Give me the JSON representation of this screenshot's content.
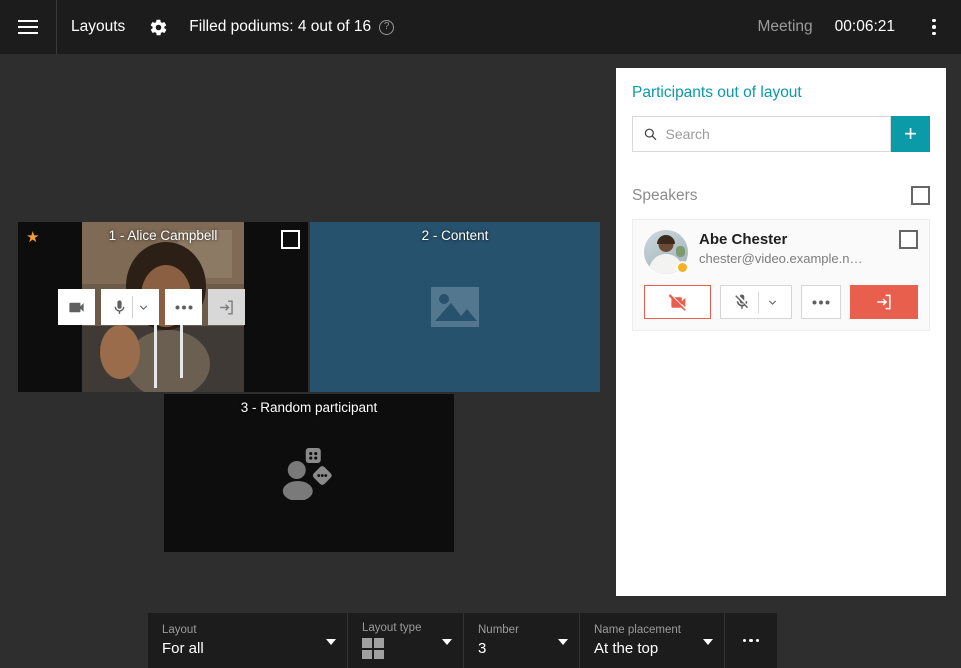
{
  "header": {
    "menu_icon": "hamburger-icon",
    "title": "Layouts",
    "settings_icon": "gear-icon",
    "podiums_text": "Filled podiums: 4 out of 16",
    "help_icon_label": "?",
    "meeting_label": "Meeting",
    "timer": "00:06:21",
    "more_icon": "kebab-menu-icon"
  },
  "stage": {
    "tiles": [
      {
        "name": "1 - Alice Campbell",
        "starred": true,
        "checked": false,
        "controls": {
          "camera": "camera-icon",
          "microphone": "microphone-icon",
          "mic_dropdown": "chevron-down-icon",
          "more": "ellipsis-icon",
          "exit": "exit-icon"
        }
      },
      {
        "name": "2 - Content",
        "icon": "image-placeholder-icon"
      },
      {
        "name": "3 - Random participant",
        "icon": "random-participant-icon"
      }
    ]
  },
  "panel": {
    "title": "Participants out of layout",
    "accent_color": "#0a9aa8",
    "search": {
      "icon": "search-icon",
      "placeholder": "Search",
      "value": ""
    },
    "add_button_label": "+",
    "speakers": {
      "label": "Speakers",
      "checked": false
    },
    "participants": [
      {
        "name": "Abe Chester",
        "email": "chester@video.example.n…",
        "status": "away",
        "checked": false,
        "buttons": {
          "camera_off": "camera-off-icon",
          "mic_muted": "microphone-muted-icon",
          "mic_dropdown": "chevron-down-icon",
          "more": "ellipsis-icon",
          "disconnect": "exit-icon"
        }
      }
    ]
  },
  "bottombar": {
    "fields": [
      {
        "label": "Layout",
        "value": "For all",
        "type": "text"
      },
      {
        "label": "Layout type",
        "value": "",
        "type": "grid-icon"
      },
      {
        "label": "Number",
        "value": "3",
        "type": "text"
      },
      {
        "label": "Name placement",
        "value": "At the top",
        "type": "text"
      }
    ],
    "more_icon": "ellipsis-icon"
  }
}
